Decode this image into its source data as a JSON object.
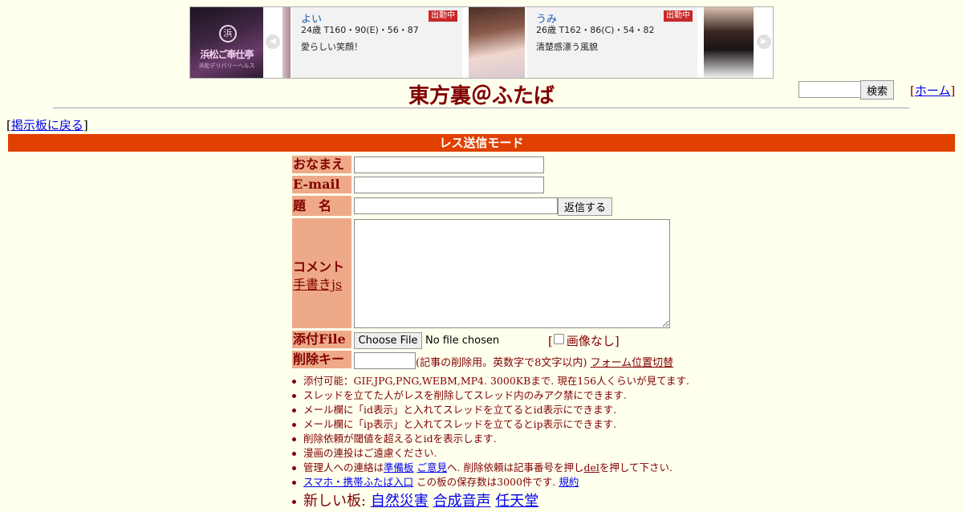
{
  "ad": {
    "logo_text": "浜松ご奉仕亭",
    "logo_sub": "浜松デリバリーヘルス",
    "logo_mark": "浜",
    "prev_icon": "◀",
    "next_icon": "▶",
    "cards": [
      {
        "name": "よい",
        "stats": "24歳 T160・90(E)・56・87",
        "desc": "愛らしい笑顔！",
        "status": "出勤中"
      },
      {
        "name": "うみ",
        "stats": "26歳 T162・86(C)・54・82",
        "desc": "清楚感漂う風貌",
        "status": "出勤中"
      }
    ]
  },
  "header": {
    "title": "東方裏＠ふたば",
    "search_button": "検索",
    "home_link": "ホーム",
    "back_link": "掲示板に戻る"
  },
  "mode_bar": "レス送信モード",
  "form": {
    "name_label": "おなまえ",
    "email_label": "E-mail",
    "subject_label": "題　名",
    "submit_button": "返信する",
    "comment_label": "コメント",
    "handwrite_link": "手書きjs",
    "file_label": "添付File",
    "file_button": "Choose File",
    "file_status": "No file chosen",
    "no_image_label": "画像なし",
    "delkey_label": "削除キー",
    "delkey_note": "(記事の削除用。英数字で8文字以内)",
    "form_position_link": "フォーム位置切替"
  },
  "notes": {
    "n1": "添付可能：GIF,JPG,PNG,WEBM,MP4. 3000KBまで. 現在156人くらいが見てます.",
    "n2": "スレッドを立てた人がレスを削除してスレッド内のみアク禁にできます.",
    "n3": "メール欄に「id表示」と入れてスレッドを立てるとid表示にできます.",
    "n4": "メール欄に「ip表示」と入れてスレッドを立てるとip表示にできます.",
    "n5": "削除依頼が閾値を超えるとidを表示します.",
    "n6": "漫画の連投はご遠慮ください.",
    "n7_pre": "管理人への連絡は",
    "n7_link1": "準備板",
    "n7_link2": "ご意見",
    "n7_mid": "へ. 削除依頼は記事番号を押し",
    "n7_del": "del",
    "n7_post": "を押して下さい.",
    "n8_link": "スマホ・携帯ふたば入口",
    "n8_mid": "この板の保存数は3000件です.",
    "n8_rules": "規約",
    "n9_pre": "新しい板:",
    "n9_link1": "自然災害",
    "n9_link2": "合成音声",
    "n9_link3": "任天堂"
  }
}
